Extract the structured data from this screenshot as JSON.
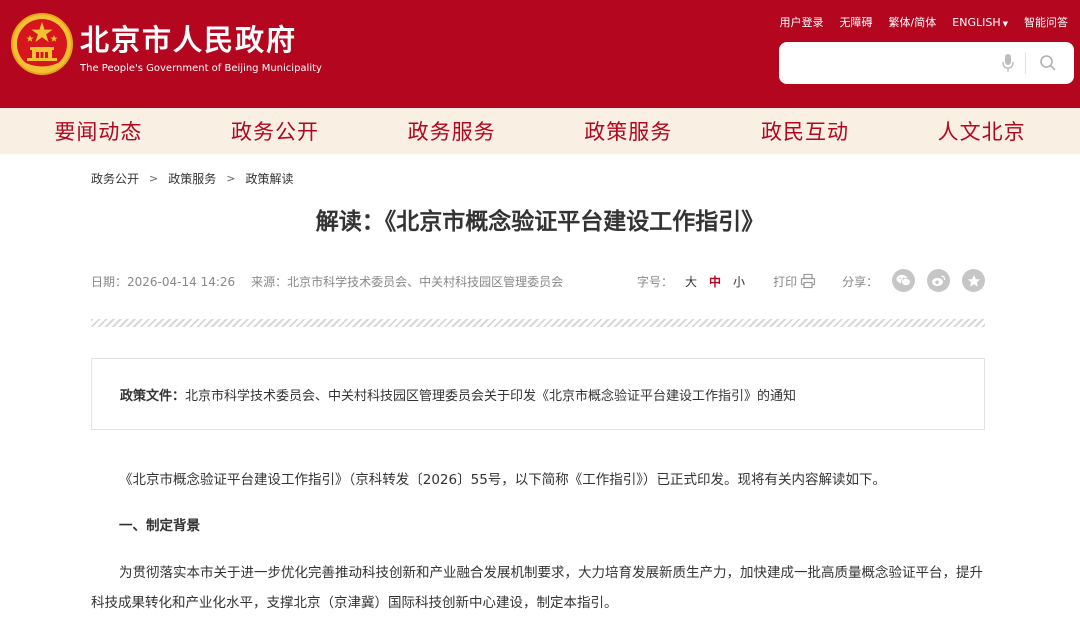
{
  "header": {
    "title_cn": "北京市人民政府",
    "title_en": "The People's Government of Beijing Municipality",
    "top_links": [
      "用户登录",
      "无障碍",
      "繁体/简体",
      "ENGLISH",
      "智能问答"
    ],
    "search_placeholder": ""
  },
  "nav": {
    "items": [
      "要闻动态",
      "政务公开",
      "政务服务",
      "政策服务",
      "政民互动",
      "人文北京"
    ]
  },
  "breadcrumb": {
    "items": [
      "政务公开",
      "政策服务",
      "政策解读"
    ],
    "separator": ">"
  },
  "article": {
    "title": "解读：《北京市概念验证平台建设工作指引》",
    "date_label": "日期：",
    "date": "2026-04-14 14:26",
    "source_label": "来源：",
    "source": "北京市科学技术委员会、中关村科技园区管理委员会",
    "font_size_label": "字号：",
    "font_sizes": [
      "大",
      "中",
      "小"
    ],
    "print_label": "打印",
    "share_label": "分享：",
    "share_icons": [
      "wechat-icon",
      "weibo-icon",
      "favorite-icon"
    ],
    "policy_label": "政策文件：",
    "policy_text": "北京市科学技术委员会、中关村科技园区管理委员会关于印发《北京市概念验证平台建设工作指引》的通知",
    "paragraph_1": "《北京市概念验证平台建设工作指引》（京科转发〔2026〕55号，以下简称《工作指引》）已正式印发。现将有关内容解读如下。",
    "heading_1": "一、制定背景",
    "paragraph_2": "为贯彻落实本市关于进一步优化完善推动科技创新和产业融合发展机制要求，大力培育发展新质生产力，加快建成一批高质量概念验证平台，提升科技成果转化和产业化水平，支撑北京（京津冀）国际科技创新中心建设，制定本指引。"
  },
  "colors": {
    "brand_red": "#b5061f",
    "nav_bg": "#f9efe3",
    "emblem_gold": "#f3c234"
  }
}
